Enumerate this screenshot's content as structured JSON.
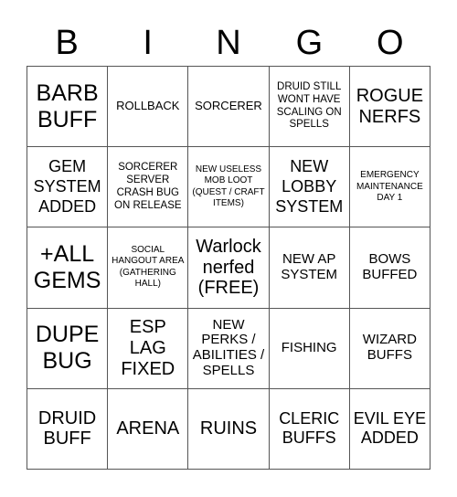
{
  "header": {
    "letters": [
      "B",
      "I",
      "N",
      "G",
      "O"
    ]
  },
  "board": {
    "rows": [
      [
        {
          "text": "BARB BUFF",
          "size": "xl"
        },
        {
          "text": "ROLLBACK",
          "size": "s"
        },
        {
          "text": "SORCERER",
          "size": "s"
        },
        {
          "text": "DRUID STILL WONT HAVE SCALING ON SPELLS",
          "size": "xs"
        },
        {
          "text": "ROGUE NERFS",
          "size": "l"
        }
      ],
      [
        {
          "text": "GEM SYSTEM ADDED",
          "size": "m"
        },
        {
          "text": "SORCERER SERVER CRASH BUG ON RELEASE",
          "size": "xs"
        },
        {
          "text": "NEW USELESS MOB LOOT (QUEST / CRAFT ITEMS)",
          "size": "xxs"
        },
        {
          "text": "NEW LOBBY SYSTEM",
          "size": "m"
        },
        {
          "text": "EMERGENCY MAINTENANCE DAY 1",
          "size": "xxs"
        }
      ],
      [
        {
          "text": "+ALL GEMS",
          "size": "xl"
        },
        {
          "text": "SOCIAL HANGOUT AREA (GATHERING HALL)",
          "size": "xxs"
        },
        {
          "text": "Warlock nerfed (FREE)",
          "size": "l"
        },
        {
          "text": "NEW AP SYSTEM",
          "size": "sm"
        },
        {
          "text": "BOWS BUFFED",
          "size": "sm"
        }
      ],
      [
        {
          "text": "DUPE BUG",
          "size": "xl"
        },
        {
          "text": "ESP LAG FIXED",
          "size": "l"
        },
        {
          "text": "NEW PERKS / ABILITIES / SPELLS",
          "size": "sm"
        },
        {
          "text": "FISHING",
          "size": "sm"
        },
        {
          "text": "WIZARD BUFFS",
          "size": "sm"
        }
      ],
      [
        {
          "text": "DRUID BUFF",
          "size": "l"
        },
        {
          "text": "ARENA",
          "size": "l"
        },
        {
          "text": "RUINS",
          "size": "l"
        },
        {
          "text": "CLERIC BUFFS",
          "size": "m"
        },
        {
          "text": "EVIL EYE ADDED",
          "size": "m"
        }
      ]
    ]
  }
}
